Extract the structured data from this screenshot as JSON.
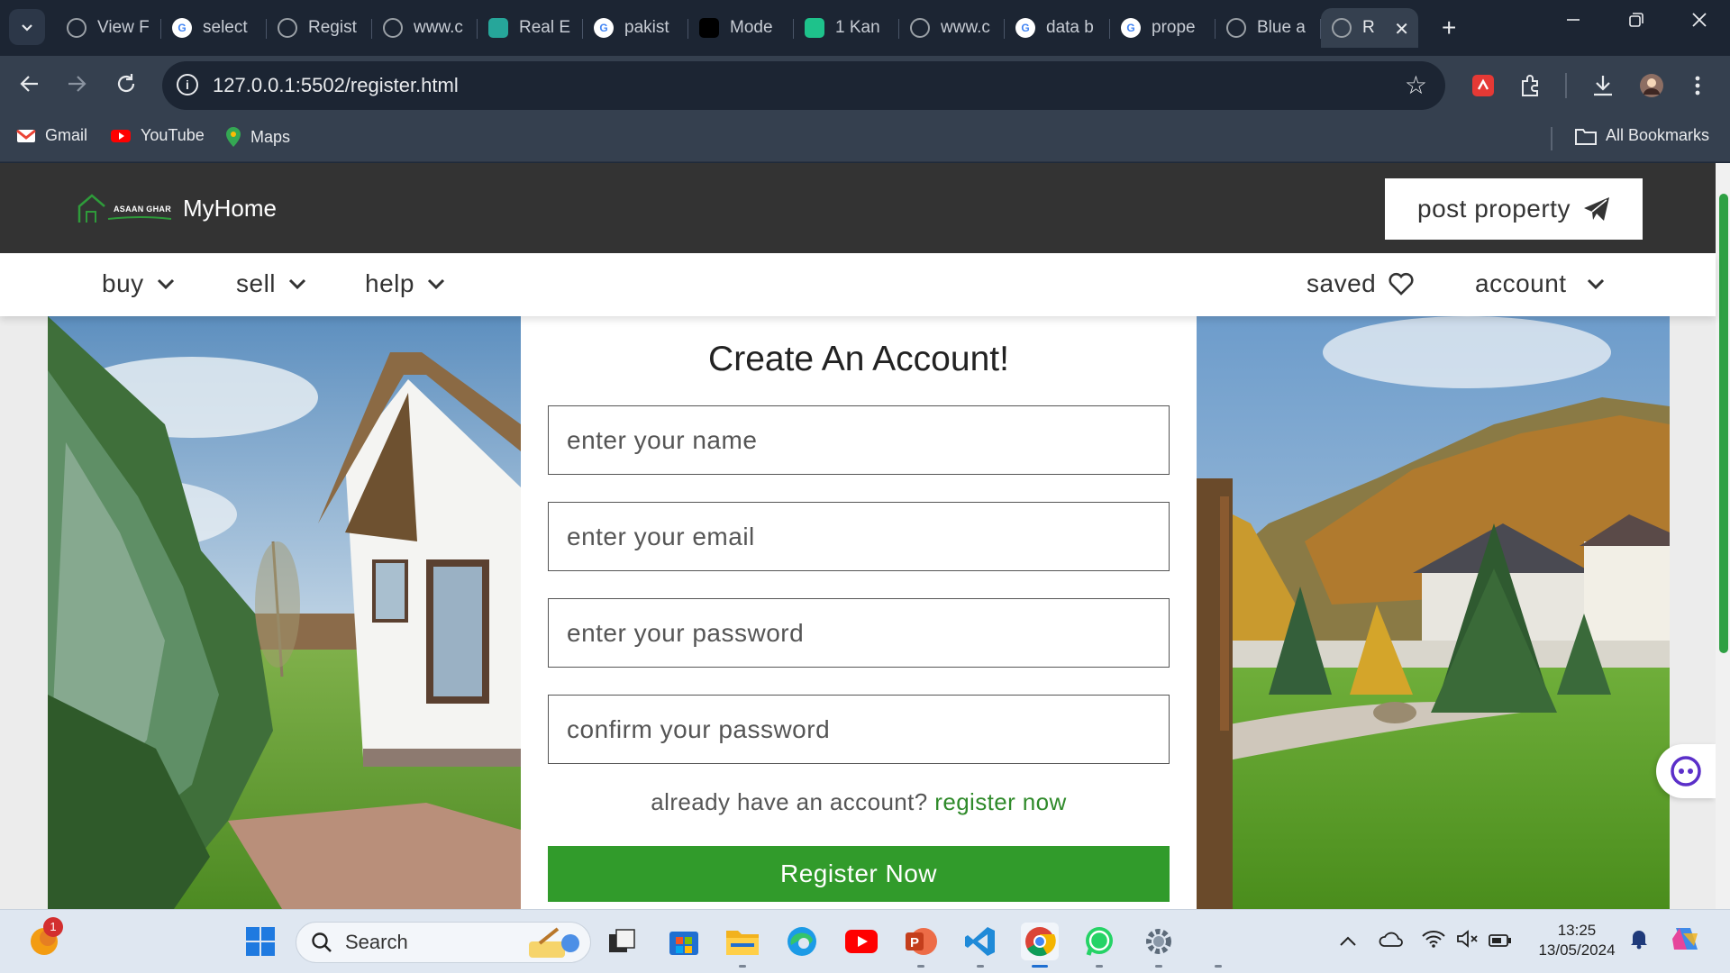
{
  "browser": {
    "tabs": [
      {
        "title": "View F",
        "icon": "globe-icon",
        "color": "#5f6368"
      },
      {
        "title": "select",
        "icon": "google-icon",
        "color": "#4285f4"
      },
      {
        "title": "Regist",
        "icon": "globe-icon",
        "color": "#5f6368"
      },
      {
        "title": "www.c",
        "icon": "globe-icon",
        "color": "#5f6368"
      },
      {
        "title": "Real E",
        "icon": "realestate-icon",
        "color": "#26a69a"
      },
      {
        "title": "pakist",
        "icon": "google-icon",
        "color": "#4285f4"
      },
      {
        "title": "Mode",
        "icon": "model-icon",
        "color": "#000000"
      },
      {
        "title": "1 Kan",
        "icon": "house-icon",
        "color": "#1ec28b"
      },
      {
        "title": "www.c",
        "icon": "globe-icon",
        "color": "#5f6368"
      },
      {
        "title": "data b",
        "icon": "google-icon",
        "color": "#4285f4"
      },
      {
        "title": "prope",
        "icon": "google-icon",
        "color": "#4285f4"
      },
      {
        "title": "Blue a",
        "icon": "globe-icon",
        "color": "#5f6368"
      },
      {
        "title": "R",
        "icon": "globe-icon",
        "color": "#5f6368",
        "active": true
      }
    ],
    "new_tab": "+",
    "url": "127.0.0.1:5502/register.html",
    "bookmarks": [
      {
        "label": "Gmail",
        "icon": "gmail-icon"
      },
      {
        "label": "YouTube",
        "icon": "youtube-icon"
      },
      {
        "label": "Maps",
        "icon": "maps-icon"
      }
    ],
    "all_bookmarks": "All Bookmarks"
  },
  "site": {
    "logo_text": "ASAAN GHAR",
    "brand": "MyHome",
    "post_property": "post property",
    "nav": {
      "buy": "buy",
      "sell": "sell",
      "help": "help",
      "saved": "saved",
      "account": "account"
    },
    "accent_color": "#319b2b"
  },
  "form": {
    "title": "Create An Account!",
    "name_placeholder": "enter your name",
    "email_placeholder": "enter your email",
    "password_placeholder": "enter your password",
    "confirm_placeholder": "confirm your password",
    "login_prompt": "already have an account?",
    "login_link": "register now",
    "submit": "Register Now"
  },
  "taskbar": {
    "search_placeholder": "Search",
    "notification_count": "1",
    "time": "13:25",
    "date": "13/05/2024"
  }
}
